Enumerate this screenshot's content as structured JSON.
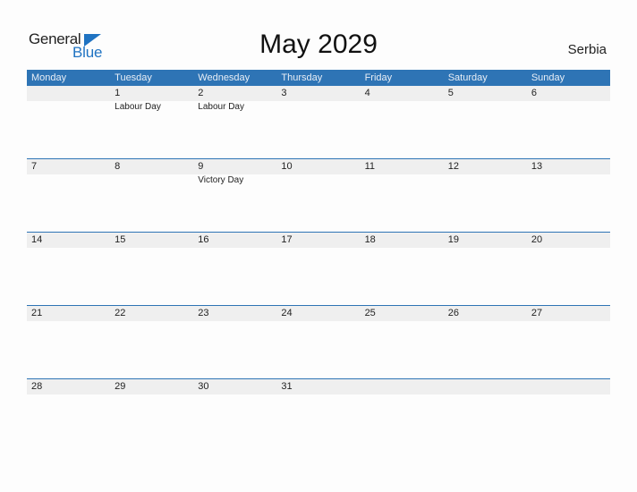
{
  "logo": {
    "text_general": "General",
    "text_blue": "Blue",
    "brand_color": "#1f73c2"
  },
  "header": {
    "title": "May 2029",
    "country": "Serbia"
  },
  "colors": {
    "header_bg": "#2e74b5",
    "strip_bg": "#efefef"
  },
  "weekdays": [
    "Monday",
    "Tuesday",
    "Wednesday",
    "Thursday",
    "Friday",
    "Saturday",
    "Sunday"
  ],
  "weeks": [
    {
      "days": [
        "",
        "1",
        "2",
        "3",
        "4",
        "5",
        "6"
      ],
      "events": [
        "",
        "Labour Day",
        "Labour Day",
        "",
        "",
        "",
        ""
      ]
    },
    {
      "days": [
        "7",
        "8",
        "9",
        "10",
        "11",
        "12",
        "13"
      ],
      "events": [
        "",
        "",
        "Victory Day",
        "",
        "",
        "",
        ""
      ]
    },
    {
      "days": [
        "14",
        "15",
        "16",
        "17",
        "18",
        "19",
        "20"
      ],
      "events": [
        "",
        "",
        "",
        "",
        "",
        "",
        ""
      ]
    },
    {
      "days": [
        "21",
        "22",
        "23",
        "24",
        "25",
        "26",
        "27"
      ],
      "events": [
        "",
        "",
        "",
        "",
        "",
        "",
        ""
      ]
    },
    {
      "days": [
        "28",
        "29",
        "30",
        "31",
        "",
        "",
        ""
      ],
      "events": [
        "",
        "",
        "",
        "",
        "",
        "",
        ""
      ]
    }
  ]
}
